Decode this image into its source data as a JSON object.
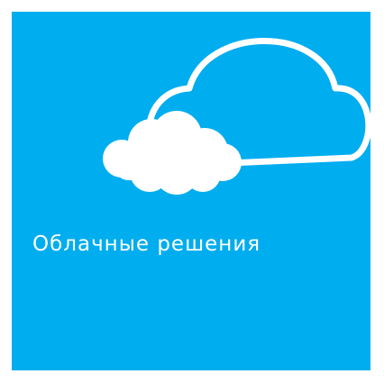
{
  "tile": {
    "label": "Облачные решения",
    "background_color": "#00adef",
    "text_color": "#ffffff",
    "icon": "cloud-icon"
  }
}
